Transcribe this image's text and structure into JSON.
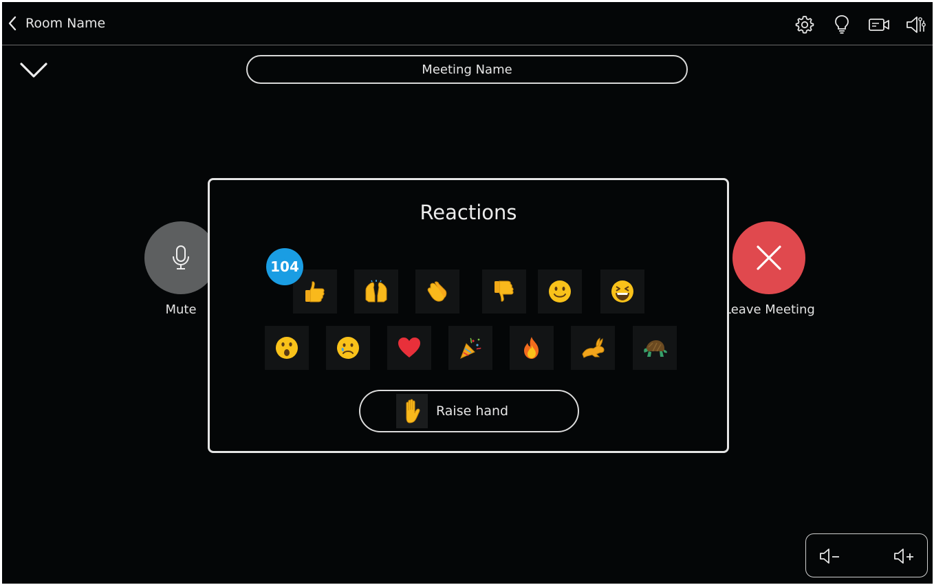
{
  "topbar": {
    "room_name": "Room Name",
    "icons": [
      "settings-icon",
      "lightbulb-icon",
      "camera-icon",
      "speaker-settings-icon"
    ]
  },
  "meeting": {
    "name": "Meeting Name"
  },
  "controls": {
    "mute_label": "Mute",
    "leave_label": "Leave Meeting"
  },
  "reactions": {
    "title": "Reactions",
    "badge_count": "104",
    "row1": [
      "thumbs-up",
      "raising-hands",
      "clapping-hands",
      "thumbs-down",
      "slightly-smiling-face",
      "grinning-squinting-face"
    ],
    "row2": [
      "astonished-face",
      "sad-face",
      "red-heart",
      "party-popper",
      "fire",
      "rabbit",
      "turtle"
    ],
    "raise_hand_label": "Raise hand"
  },
  "colors": {
    "background": "#040607",
    "mute_button": "#5d5f60",
    "leave_button": "#e0494e",
    "badge": "#1a9de3",
    "emoji_yellow": "#f9c21a"
  }
}
